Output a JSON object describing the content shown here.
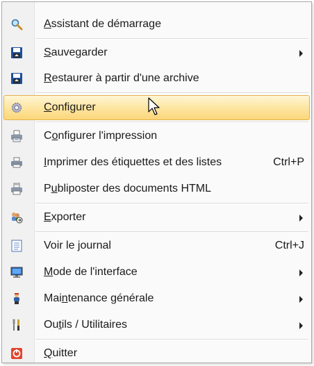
{
  "menu": {
    "items": [
      {
        "pre": "",
        "mn": "A",
        "post": "ssistant de démarrage",
        "shortcut": "",
        "submenu": false,
        "icon": "magnifier-icon"
      },
      {
        "pre": "",
        "mn": "S",
        "post": "auvegarder",
        "shortcut": "",
        "submenu": true,
        "icon": "save-disk-icon"
      },
      {
        "pre": "",
        "mn": "R",
        "post": "estaurer à partir d'une archive",
        "shortcut": "",
        "submenu": false,
        "icon": "restore-disk-icon"
      },
      {
        "pre": "",
        "mn": "C",
        "post": "onfigurer",
        "shortcut": "",
        "submenu": false,
        "icon": "gear-icon",
        "highlighted": true
      },
      {
        "pre": "C",
        "mn": "o",
        "post": "nfigurer l'impression",
        "shortcut": "",
        "submenu": false,
        "icon": "printer-settings-icon"
      },
      {
        "pre": "",
        "mn": "I",
        "post": "mprimer des étiquettes et des listes",
        "shortcut": "Ctrl+P",
        "submenu": false,
        "icon": "printer-icon"
      },
      {
        "pre": "P",
        "mn": "u",
        "post": "bliposter des documents HTML",
        "shortcut": "",
        "submenu": false,
        "icon": "mail-merge-printer-icon"
      },
      {
        "pre": "",
        "mn": "E",
        "post": "xporter",
        "shortcut": "",
        "submenu": true,
        "icon": "export-users-icon"
      },
      {
        "pre": "Voir le ",
        "mn": "j",
        "post": "ournal",
        "shortcut": "Ctrl+J",
        "submenu": false,
        "icon": "journal-icon"
      },
      {
        "pre": "",
        "mn": "M",
        "post": "ode de l'interface",
        "shortcut": "",
        "submenu": true,
        "icon": "monitor-icon"
      },
      {
        "pre": "Mai",
        "mn": "n",
        "post": "tenance générale",
        "shortcut": "",
        "submenu": true,
        "icon": "maintenance-person-icon"
      },
      {
        "pre": "Ou",
        "mn": "t",
        "post": "ils / Utilitaires",
        "shortcut": "",
        "submenu": true,
        "icon": "tools-icon"
      },
      {
        "pre": "",
        "mn": "Q",
        "post": "uitter",
        "shortcut": "",
        "submenu": false,
        "icon": "quit-icon"
      }
    ]
  },
  "colors": {
    "highlight": "#fcd679",
    "highlight_border": "#e4b04d",
    "quit_red": "#e2442f"
  }
}
